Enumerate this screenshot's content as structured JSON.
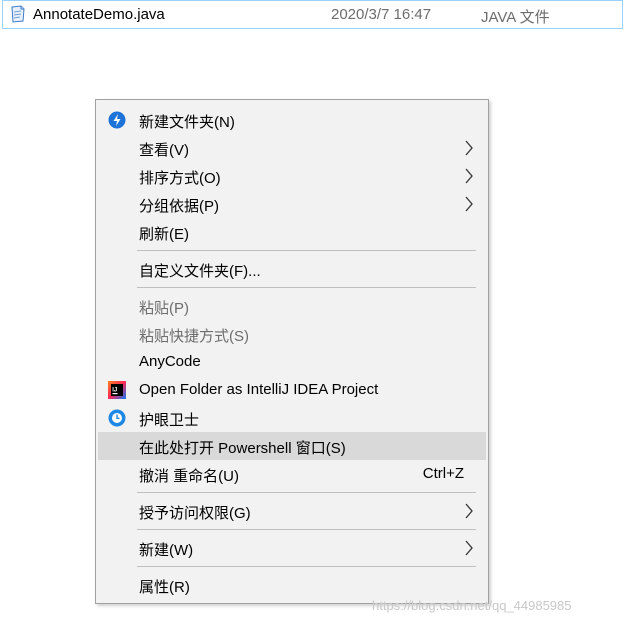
{
  "file": {
    "name": "AnnotateDemo.java",
    "date": "2020/3/7 16:47",
    "type": "JAVA 文件",
    "icon": "java-file-icon"
  },
  "menu": {
    "items": [
      {
        "label": "新建文件夹(N)",
        "mnemonic": "N",
        "icon": "new-folder-icon",
        "accent": "#1e73d8"
      },
      {
        "label": "查看(V)",
        "mnemonic": "V",
        "submenu": true
      },
      {
        "label": "排序方式(O)",
        "mnemonic": "O",
        "submenu": true
      },
      {
        "label": "分组依据(P)",
        "mnemonic": "P",
        "submenu": true
      },
      {
        "label": "刷新(E)",
        "mnemonic": "E"
      },
      {
        "label": "自定义文件夹(F)...",
        "mnemonic": "F"
      },
      {
        "label": "粘贴(P)",
        "mnemonic": "P",
        "disabled": true
      },
      {
        "label": "粘贴快捷方式(S)",
        "mnemonic": "S",
        "disabled": true
      },
      {
        "label": "AnyCode",
        "mnemonic": "A"
      },
      {
        "label": "Open Folder as IntelliJ IDEA Project",
        "icon": "intellij-icon"
      },
      {
        "label": "护眼卫士",
        "icon": "eye-guard-icon",
        "accent": "#1e88e5"
      },
      {
        "label": "在此处打开 Powershell 窗口(S)",
        "mnemonic": "S",
        "highlighted": true
      },
      {
        "label": "撤消 重命名(U)",
        "mnemonic": "U",
        "shortcut": "Ctrl+Z"
      },
      {
        "label": "授予访问权限(G)",
        "mnemonic": "G",
        "submenu": true
      },
      {
        "label": "新建(W)",
        "mnemonic": "W",
        "submenu": true
      },
      {
        "label": "属性(R)",
        "mnemonic": "R"
      }
    ]
  },
  "watermark": "https://blog.csdn.net/qq_44985985"
}
